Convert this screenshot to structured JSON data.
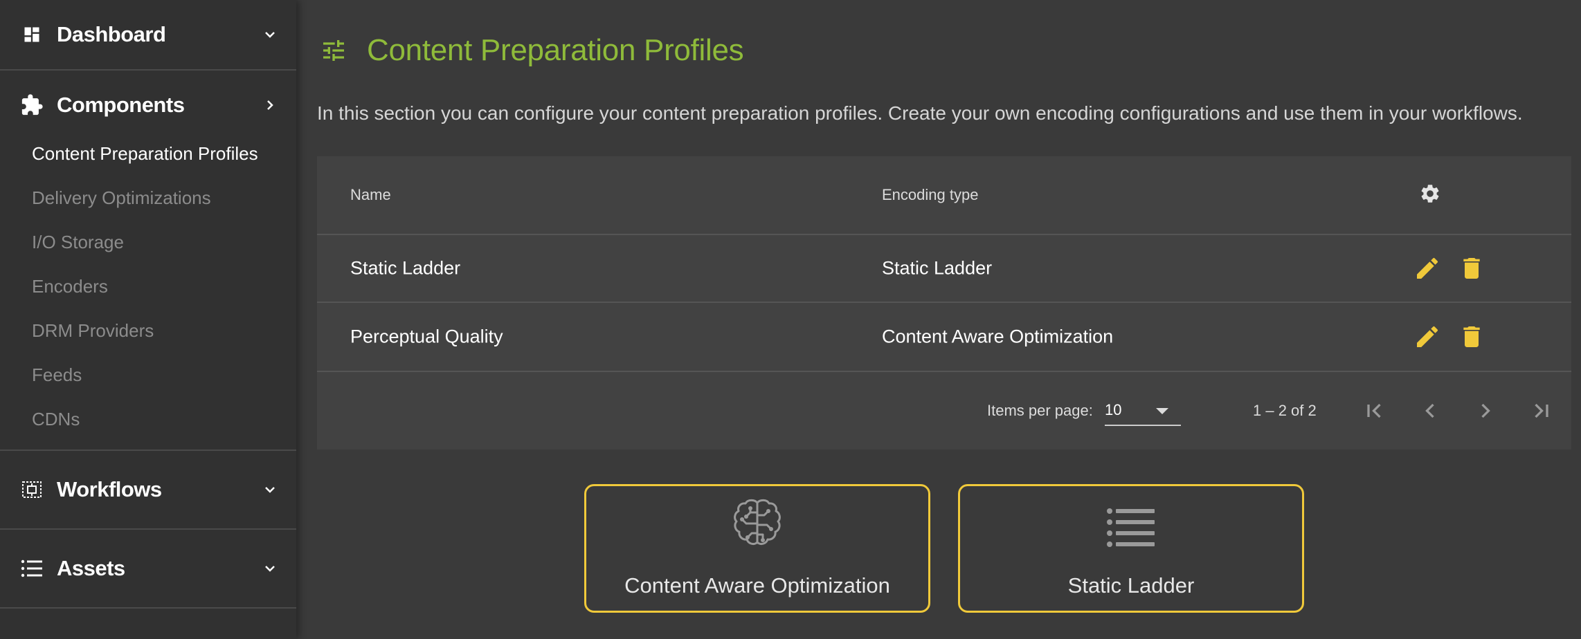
{
  "sidebar": {
    "dashboard": {
      "label": "Dashboard",
      "icon": "dashboard-icon"
    },
    "components": {
      "label": "Components",
      "icon": "puzzle-icon",
      "items": [
        {
          "label": "Content Preparation Profiles",
          "active": true
        },
        {
          "label": "Delivery Optimizations"
        },
        {
          "label": "I/O Storage"
        },
        {
          "label": "Encoders"
        },
        {
          "label": "DRM Providers"
        },
        {
          "label": "Feeds"
        },
        {
          "label": "CDNs"
        }
      ]
    },
    "workflows": {
      "label": "Workflows",
      "icon": "workflow-icon"
    },
    "assets": {
      "label": "Assets",
      "icon": "list-icon"
    }
  },
  "page": {
    "title": "Content Preparation Profiles",
    "title_icon": "tune-icon",
    "description": "In this section you can configure your content preparation profiles. Create your own encoding configurations and use them in your workflows."
  },
  "table": {
    "columns": {
      "name": "Name",
      "type": "Encoding type",
      "settings_icon": "gear-icon"
    },
    "rows": [
      {
        "name": "Static Ladder",
        "type": "Static Ladder"
      },
      {
        "name": "Perceptual Quality",
        "type": "Content Aware Optimization"
      }
    ]
  },
  "pagination": {
    "items_per_page_label": "Items per page:",
    "items_per_page": "10",
    "range": "1 – 2 of 2"
  },
  "cards": [
    {
      "label": "Content Aware Optimization",
      "icon": "brain-icon"
    },
    {
      "label": "Static Ladder",
      "icon": "list-icon"
    }
  ],
  "colors": {
    "accent_green": "#8fbb3a",
    "accent_yellow": "#f0c93a",
    "sidebar_bg": "#313131",
    "main_bg": "#3a3a3a",
    "table_bg": "#424242"
  }
}
